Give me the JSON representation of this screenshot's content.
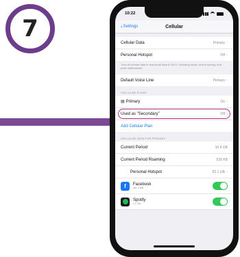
{
  "step": {
    "number": "7"
  },
  "colors": {
    "accent": "#6b3d8a",
    "highlight": "#b0308e",
    "link": "#1a7cf5",
    "toggle_on": "#34c759"
  },
  "status_bar": {
    "time": "10:22"
  },
  "navbar": {
    "back_label": "Settings",
    "title": "Cellular"
  },
  "group1": {
    "rows": [
      {
        "label": "Cellular Data",
        "value": "Primary"
      },
      {
        "label": "Personal Hotspot",
        "value": "Off"
      }
    ],
    "note": "Turn off cellular data to restrict all data to Wi-Fi, including email, web browsing, and push notifications."
  },
  "group2": {
    "rows": [
      {
        "label": "Default Voice Line",
        "value": "Primary"
      }
    ]
  },
  "cellular_plans": {
    "header": "CELLULAR PLANS",
    "rows": [
      {
        "label": "Primary",
        "value": "On"
      },
      {
        "label": "Used as \"Secondary\"",
        "value": "Off"
      }
    ],
    "add_link": "Add Cellular Plan"
  },
  "cellular_data_for": {
    "header": "CELLULAR DATA FOR PRIMARY",
    "rows": [
      {
        "label": "Current Period",
        "value": "10.4 GB"
      },
      {
        "label": "Current Period Roaming",
        "value": "639 KB"
      },
      {
        "label": "Personal Hotspot",
        "value": "50.1 GB"
      }
    ]
  },
  "apps": [
    {
      "name": "Facebook",
      "sub": "461.3 MB",
      "icon": "facebook-icon",
      "enabled": true
    },
    {
      "name": "Spotify",
      "sub": "1.1 GB",
      "icon": "spotify-icon",
      "enabled": true
    }
  ]
}
